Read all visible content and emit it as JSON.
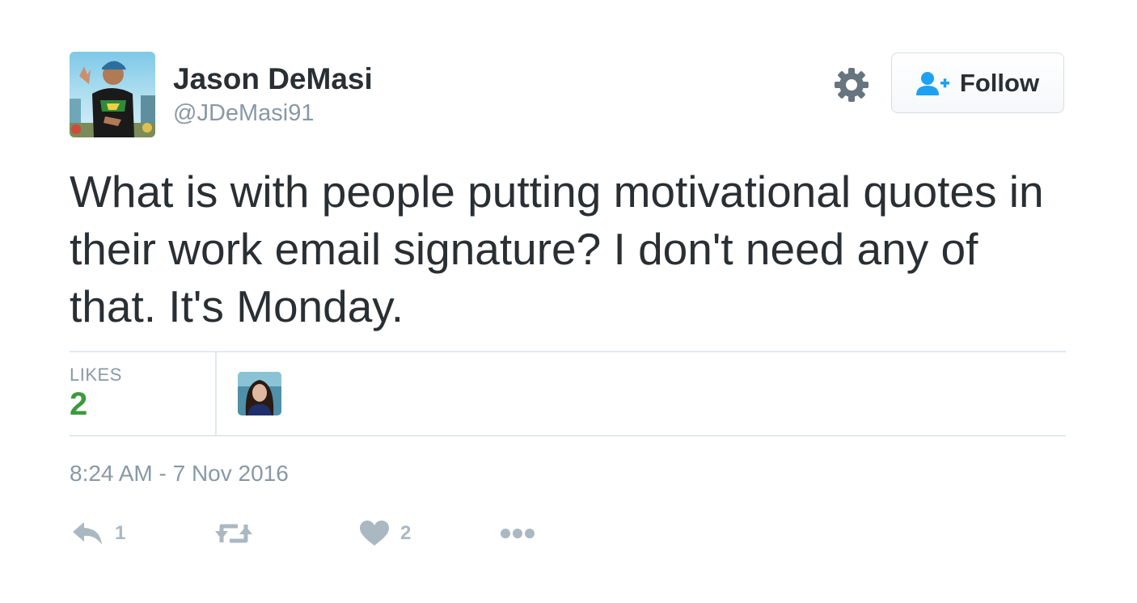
{
  "author": {
    "name": "Jason DeMasi",
    "handle": "@JDeMasi91",
    "avatar_icon": "profile-photo-man-in-cap"
  },
  "header": {
    "settings_icon": "gear-icon",
    "follow_label": "Follow",
    "follow_icon": "add-user-icon"
  },
  "tweet": {
    "text": "What is with people putting motivational quotes in their work email signature? I don't need any of that. It's Monday."
  },
  "stats": {
    "likes_label": "LIKES",
    "likes_count": "2",
    "liker_avatar_icon": "profile-photo-woman"
  },
  "timestamp": "8:24 AM - 7 Nov 2016",
  "actions": {
    "reply_count": "1",
    "retweet_count": "",
    "like_count": "2",
    "reply_icon": "reply-icon",
    "retweet_icon": "retweet-icon",
    "like_icon": "heart-icon",
    "more_icon": "more-dots-icon"
  },
  "colors": {
    "text": "#292f33",
    "muted": "#8899a6",
    "action_gray": "#aab8c2",
    "likes_green": "#3c9a3c",
    "follow_blue": "#1da1f2",
    "divider": "#e1e8ed"
  }
}
